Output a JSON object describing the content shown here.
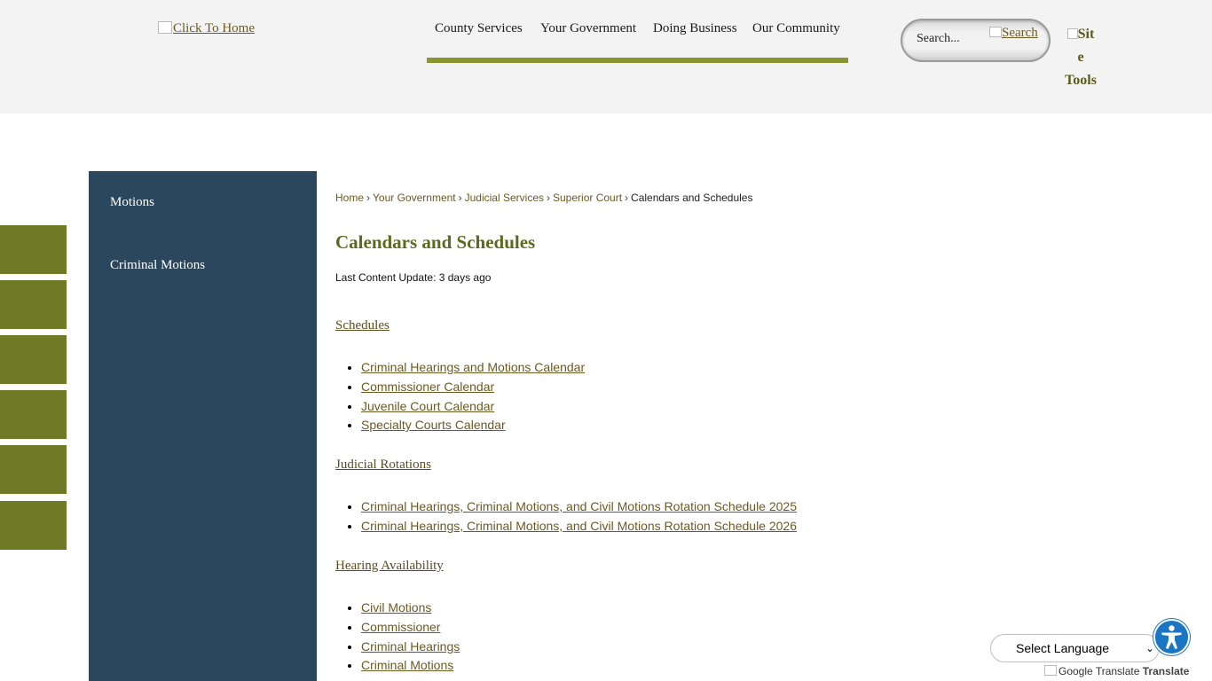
{
  "header": {
    "logo_alt": "Click To Home",
    "nav": [
      "County Services",
      "Your Government",
      "Doing Business",
      "Our Community"
    ],
    "search": {
      "placeholder": "Search...",
      "button_alt": "Search"
    },
    "site_tools": [
      "Sit",
      "e",
      "Tools"
    ]
  },
  "sidebar": {
    "items": [
      "Motions",
      "Criminal Motions"
    ]
  },
  "breadcrumb": {
    "links": [
      "Home",
      "Your Government",
      "Judicial Services",
      "Superior Court"
    ],
    "current": "Calendars and Schedules"
  },
  "page": {
    "title": "Calendars and Schedules",
    "last_update": "Last Content Update: 3 days ago"
  },
  "sections": [
    {
      "heading": "Schedules",
      "links": [
        "Criminal Hearings and Motions Calendar",
        "Commissioner Calendar",
        "Juvenile Court Calendar",
        "Specialty Courts Calendar"
      ]
    },
    {
      "heading": "Judicial Rotations",
      "links": [
        "Criminal Hearings, Criminal Motions, and Civil Motions Rotation Schedule 2025",
        "Criminal Hearings, Criminal Motions, and Civil Motions Rotation Schedule 2026"
      ]
    },
    {
      "heading": "Hearing Availability",
      "links": [
        "Civil Motions",
        "Commissioner",
        "Criminal Hearings",
        "Criminal Motions"
      ]
    }
  ],
  "translate": {
    "select_label": "Select Language",
    "powered_by_alt": "Google Translate",
    "powered_by_text": "Translate"
  },
  "colors": {
    "olive_accent": "#6e7a25",
    "nav_bar": "#8a9530",
    "sidebar_bg": "#2a475e",
    "title_green": "#5c6a1f",
    "link_brown": "#6b5a22",
    "accessibility_blue": "#1a75c4"
  },
  "icons": {
    "accessibility": "accessibility-person-icon",
    "broken_image": "broken-image-icon"
  }
}
